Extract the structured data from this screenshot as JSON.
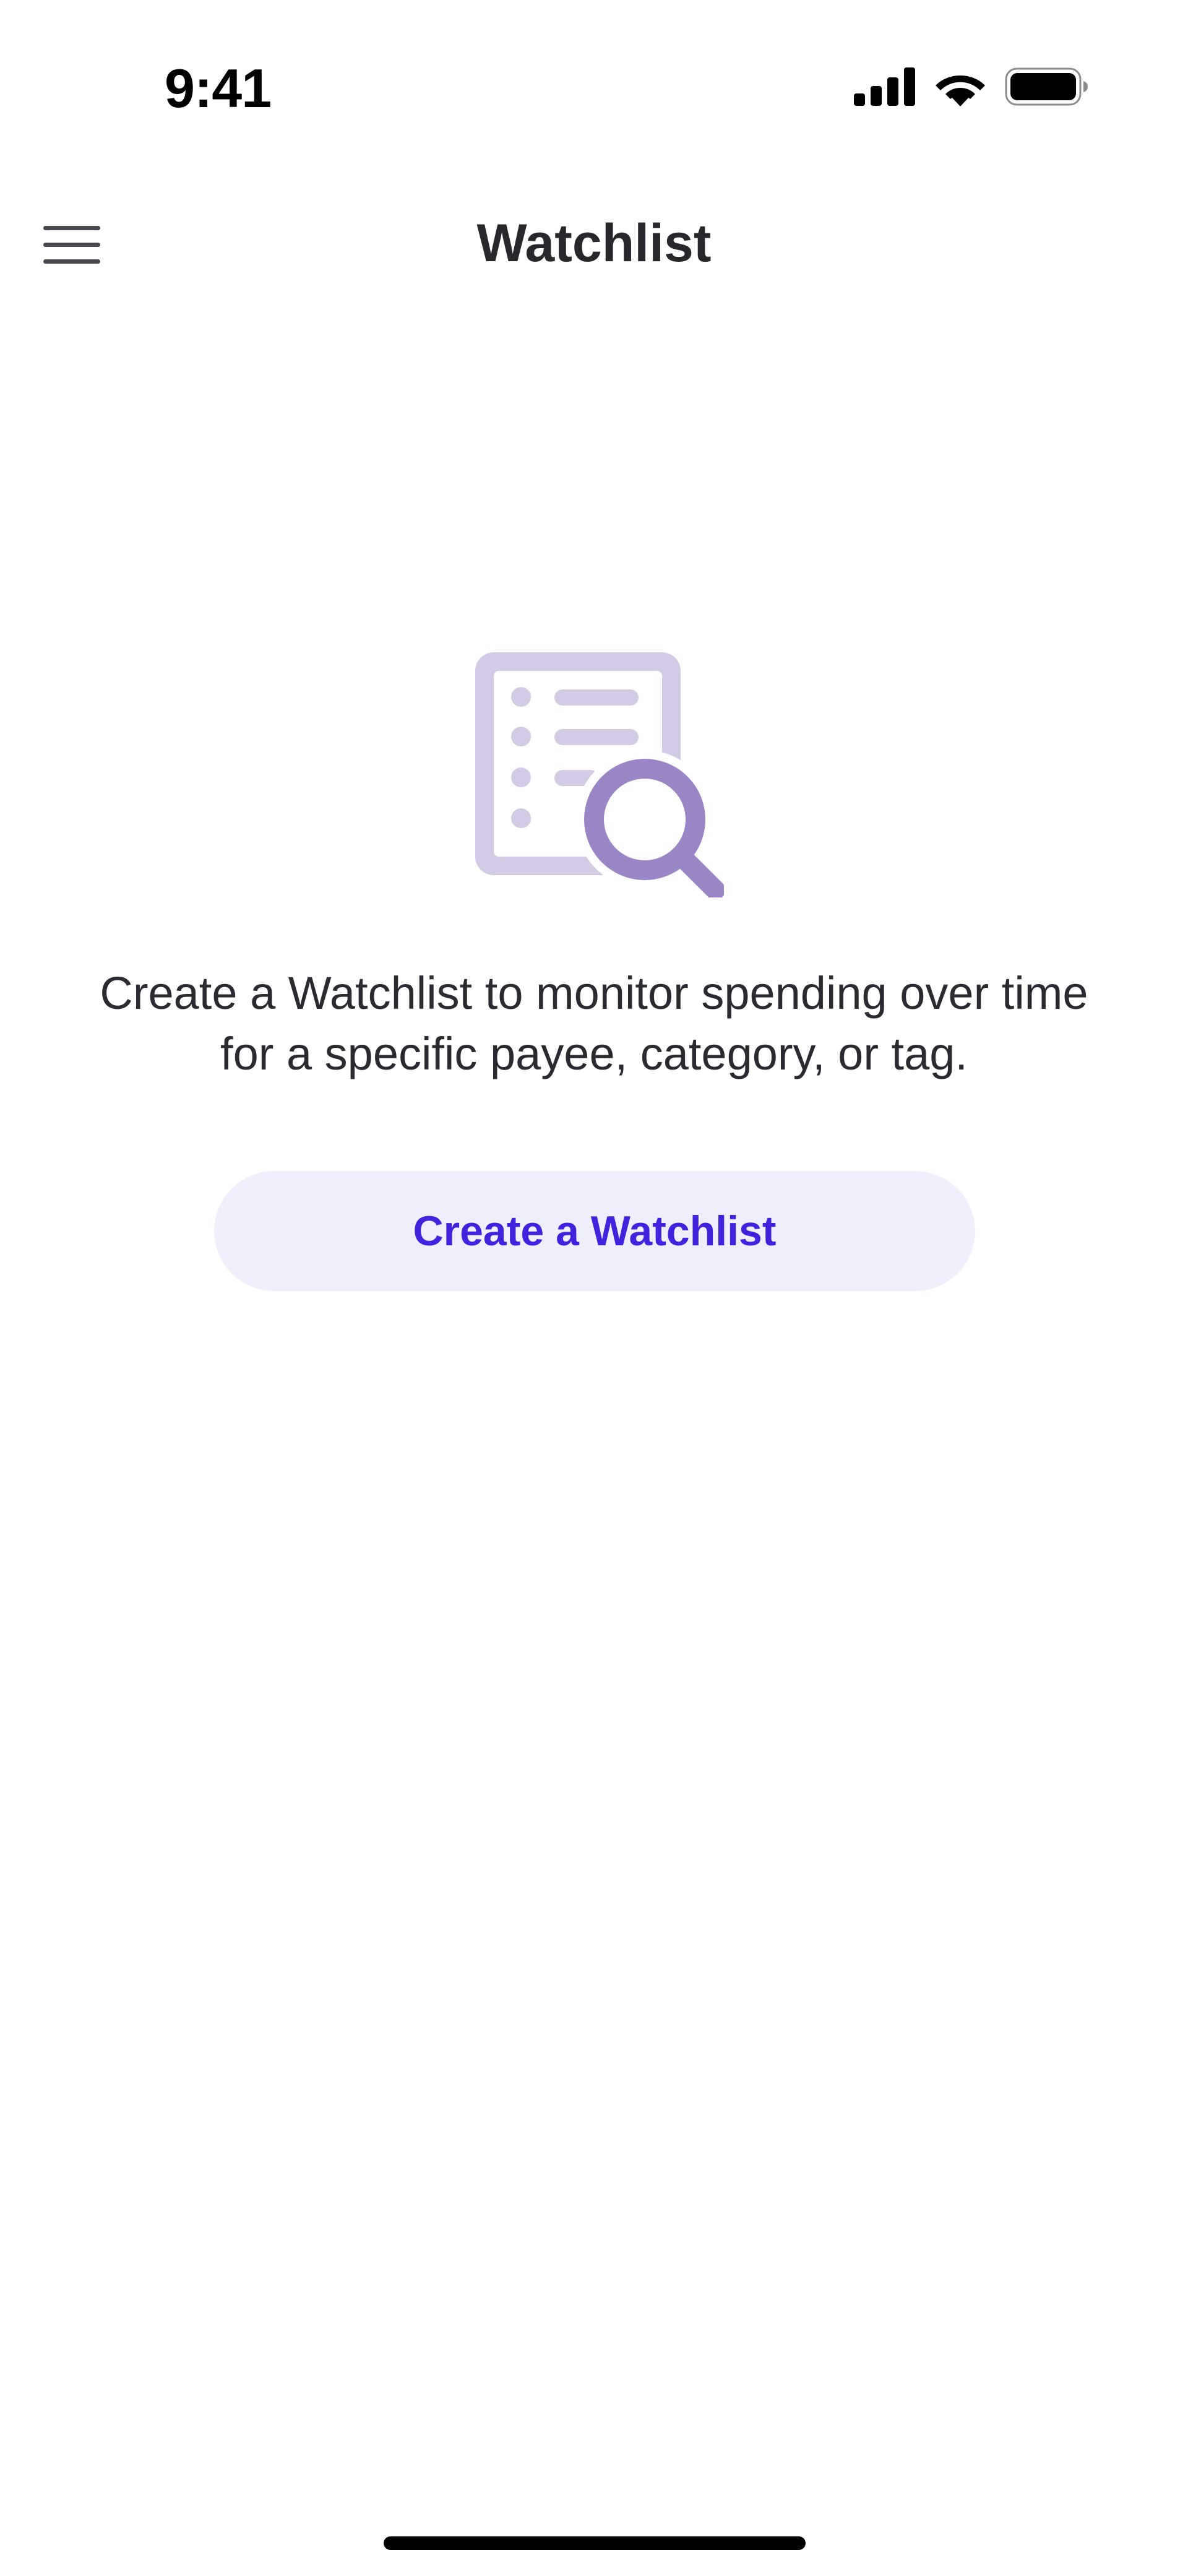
{
  "status_bar": {
    "time": "9:41",
    "icons": [
      "cellular-signal-icon",
      "wifi-icon",
      "battery-icon"
    ]
  },
  "nav": {
    "title": "Watchlist",
    "menu_icon": "hamburger-menu-icon"
  },
  "empty_state": {
    "illustration_icon": "document-search-icon",
    "message": "Create a Watchlist to monitor spending over time for a specific payee, category, or tag.",
    "create_button_label": "Create a Watchlist"
  },
  "colors": {
    "accent": "#4322dd",
    "button_background": "#efeffb",
    "illustration_light": "#d3cbe6",
    "illustration_dark": "#9a86c7"
  }
}
